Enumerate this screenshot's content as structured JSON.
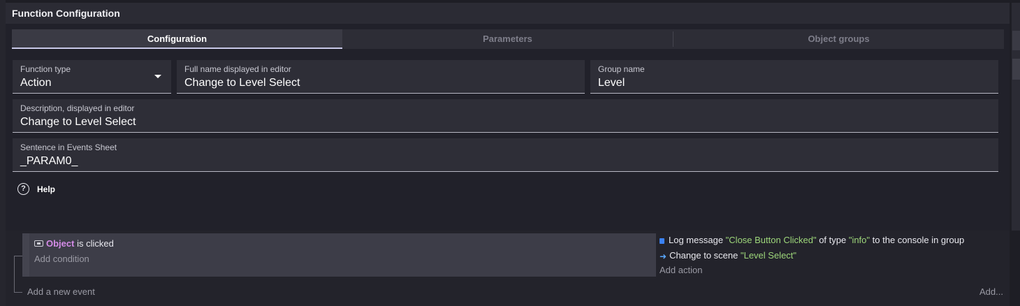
{
  "panel": {
    "title": "Function Configuration"
  },
  "tabs": [
    {
      "label": "Configuration",
      "active": true
    },
    {
      "label": "Parameters",
      "active": false
    },
    {
      "label": "Object groups",
      "active": false
    }
  ],
  "fields": {
    "function_type": {
      "label": "Function type",
      "value": "Action"
    },
    "full_name": {
      "label": "Full name displayed in editor",
      "value": "Change to Level Select"
    },
    "group_name": {
      "label": "Group name",
      "value": "Level"
    },
    "description": {
      "label": "Description, displayed in editor",
      "value": "Change to Level Select"
    },
    "sentence": {
      "label": "Sentence in Events Sheet",
      "value": "_PARAM0_"
    }
  },
  "help": {
    "label": "Help",
    "icon": "question-circle-icon"
  },
  "events": {
    "condition": {
      "object": "Object",
      "text": " is clicked"
    },
    "add_condition": "Add condition",
    "actions": [
      {
        "icon": "log-icon",
        "parts": [
          "Log message ",
          "\"Close Button Clicked\"",
          " of type ",
          "\"info\"",
          " to the console in group"
        ]
      },
      {
        "icon": "scene-arrow-icon",
        "parts": [
          "Change to scene ",
          "\"Level Select\""
        ]
      }
    ],
    "add_action": "Add action",
    "add_event": "Add a new event",
    "add_more": "Add..."
  },
  "colors": {
    "background": "#1e1e25",
    "object_name": "#d58ce8",
    "string_literal": "#9dd67a",
    "active_tab_underline": "#c8c8e8"
  }
}
